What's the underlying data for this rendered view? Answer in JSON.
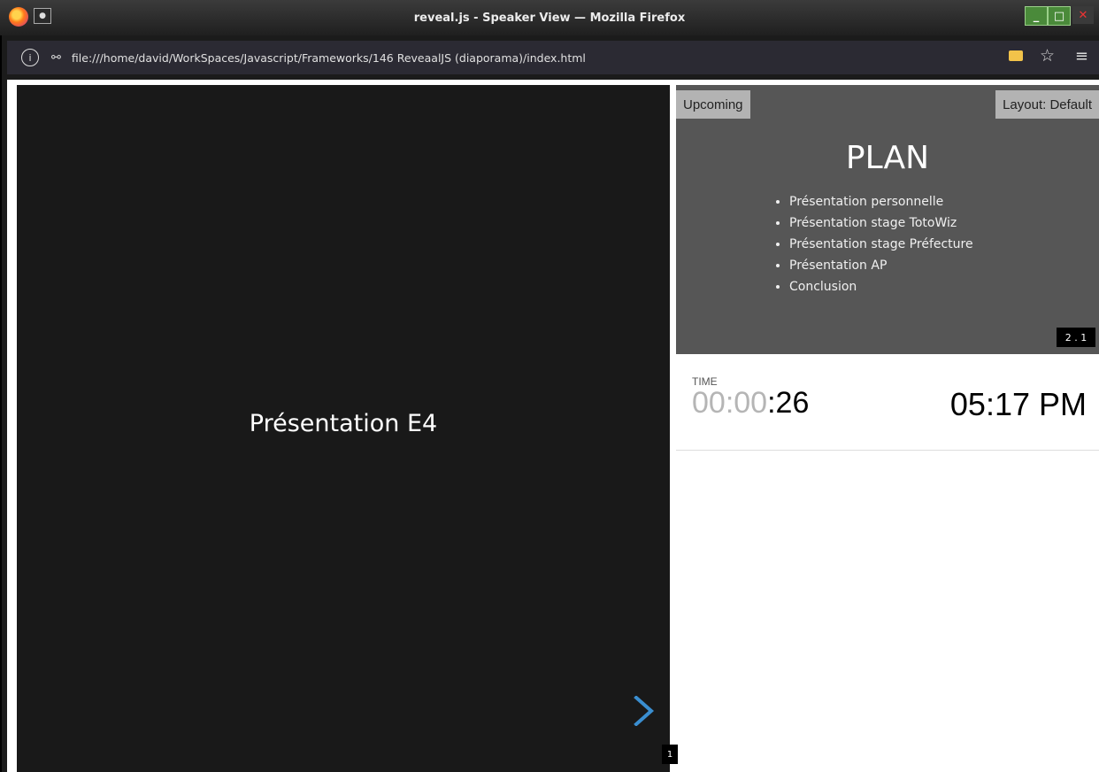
{
  "window": {
    "title": "reveal.js - Speaker View — Mozilla Firefox",
    "pin_glyph": "●",
    "minimize_glyph": "_",
    "maximize_glyph": "□",
    "close_glyph": "✕"
  },
  "urlbar": {
    "info_glyph": "i",
    "permissions_glyph": "⚯",
    "url": "file:///home/david/WorkSpaces/Javascript/Frameworks/146 ReveaalJS (diaporama)/index.html",
    "star_glyph": "☆",
    "menu_glyph": "≡"
  },
  "current_slide": {
    "heading": "Présentation E4",
    "slide_number": "1",
    "accent_color": "#3a8ed0"
  },
  "upcoming": {
    "label": "Upcoming",
    "layout_label": "Layout: Default",
    "title": "PLAN",
    "items": [
      "Présentation personnelle",
      "Présentation stage TotoWiz",
      "Présentation stage Préfecture",
      "Présentation AP",
      "Conclusion"
    ],
    "slide_number": "2 . 1"
  },
  "time": {
    "label": "TIME",
    "timer_muted": "00:00",
    "timer_active": ":26",
    "clock": "05:17 PM"
  }
}
